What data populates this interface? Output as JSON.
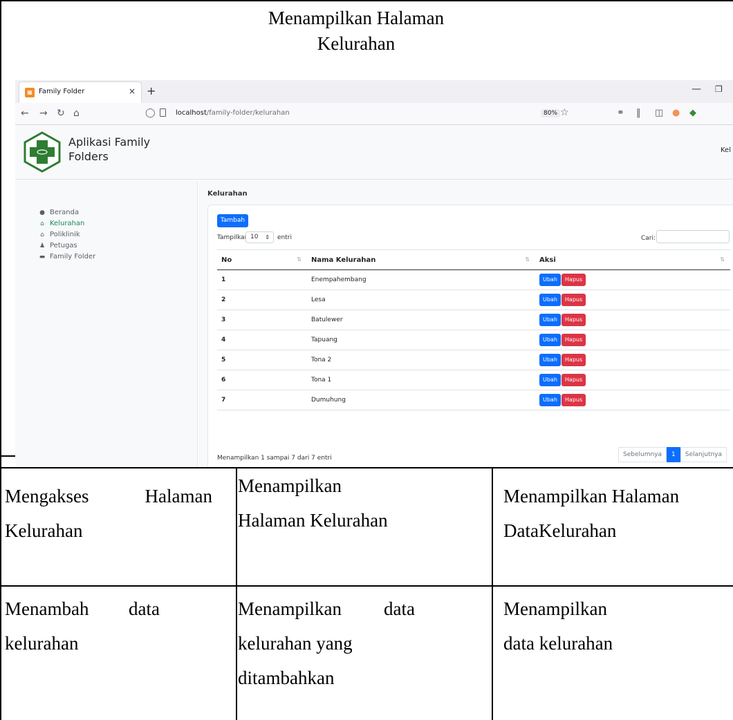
{
  "document": {
    "title_line1": "Menampilkan Halaman",
    "title_line2": "Kelurahan",
    "rows": [
      {
        "col1": [
          "Mengakses Halaman",
          "Kelurahan"
        ],
        "col2": [
          "Menampilkan",
          "Halaman Kelurahan"
        ],
        "col3": [
          "Menampilkan Halaman",
          "DataKelurahan"
        ]
      },
      {
        "col1": [
          "Menambah data",
          "kelurahan"
        ],
        "col2": [
          "Menampilkan data",
          "kelurahan yang",
          "ditambahkan"
        ],
        "col3": [
          "Menampilkan",
          "data kelurahan"
        ]
      }
    ]
  },
  "browser": {
    "tab_title": "Family Folder",
    "url_host": "localhost",
    "url_path": "/family-folder/kelurahan",
    "zoom": "80%"
  },
  "app": {
    "name": "Aplikasi Family Folders",
    "header_right": "Kel",
    "sidebar": [
      {
        "label": "Beranda",
        "icon": "palette-icon",
        "active": false
      },
      {
        "label": "Kelurahan",
        "icon": "home-icon",
        "active": true
      },
      {
        "label": "Poliklinik",
        "icon": "home-icon",
        "active": false
      },
      {
        "label": "Petugas",
        "icon": "user-icon",
        "active": false
      },
      {
        "label": "Family Folder",
        "icon": "folder-icon",
        "active": false
      }
    ],
    "page_title": "Kelurahan",
    "add_button": "Tambah",
    "show_label": "Tampilkan",
    "show_value": "10",
    "show_suffix": "entri",
    "search_label": "Cari:",
    "columns": [
      "No",
      "Nama Kelurahan",
      "Aksi"
    ],
    "rows": [
      {
        "no": "1",
        "name": "Enempahembang"
      },
      {
        "no": "2",
        "name": "Lesa"
      },
      {
        "no": "3",
        "name": "Batulewer"
      },
      {
        "no": "4",
        "name": "Tapuang"
      },
      {
        "no": "5",
        "name": "Tona 2"
      },
      {
        "no": "6",
        "name": "Tona 1"
      },
      {
        "no": "7",
        "name": "Dumuhung"
      }
    ],
    "edit_label": "Ubah",
    "delete_label": "Hapus",
    "info": "Menampilkan 1 sampai 7 dari 7 entri",
    "pager": {
      "prev": "Sebelumnya",
      "current": "1",
      "next": "Selanjutnya"
    },
    "colors": {
      "primary": "#0d6efd",
      "danger": "#dc3545",
      "active": "#198754"
    }
  }
}
